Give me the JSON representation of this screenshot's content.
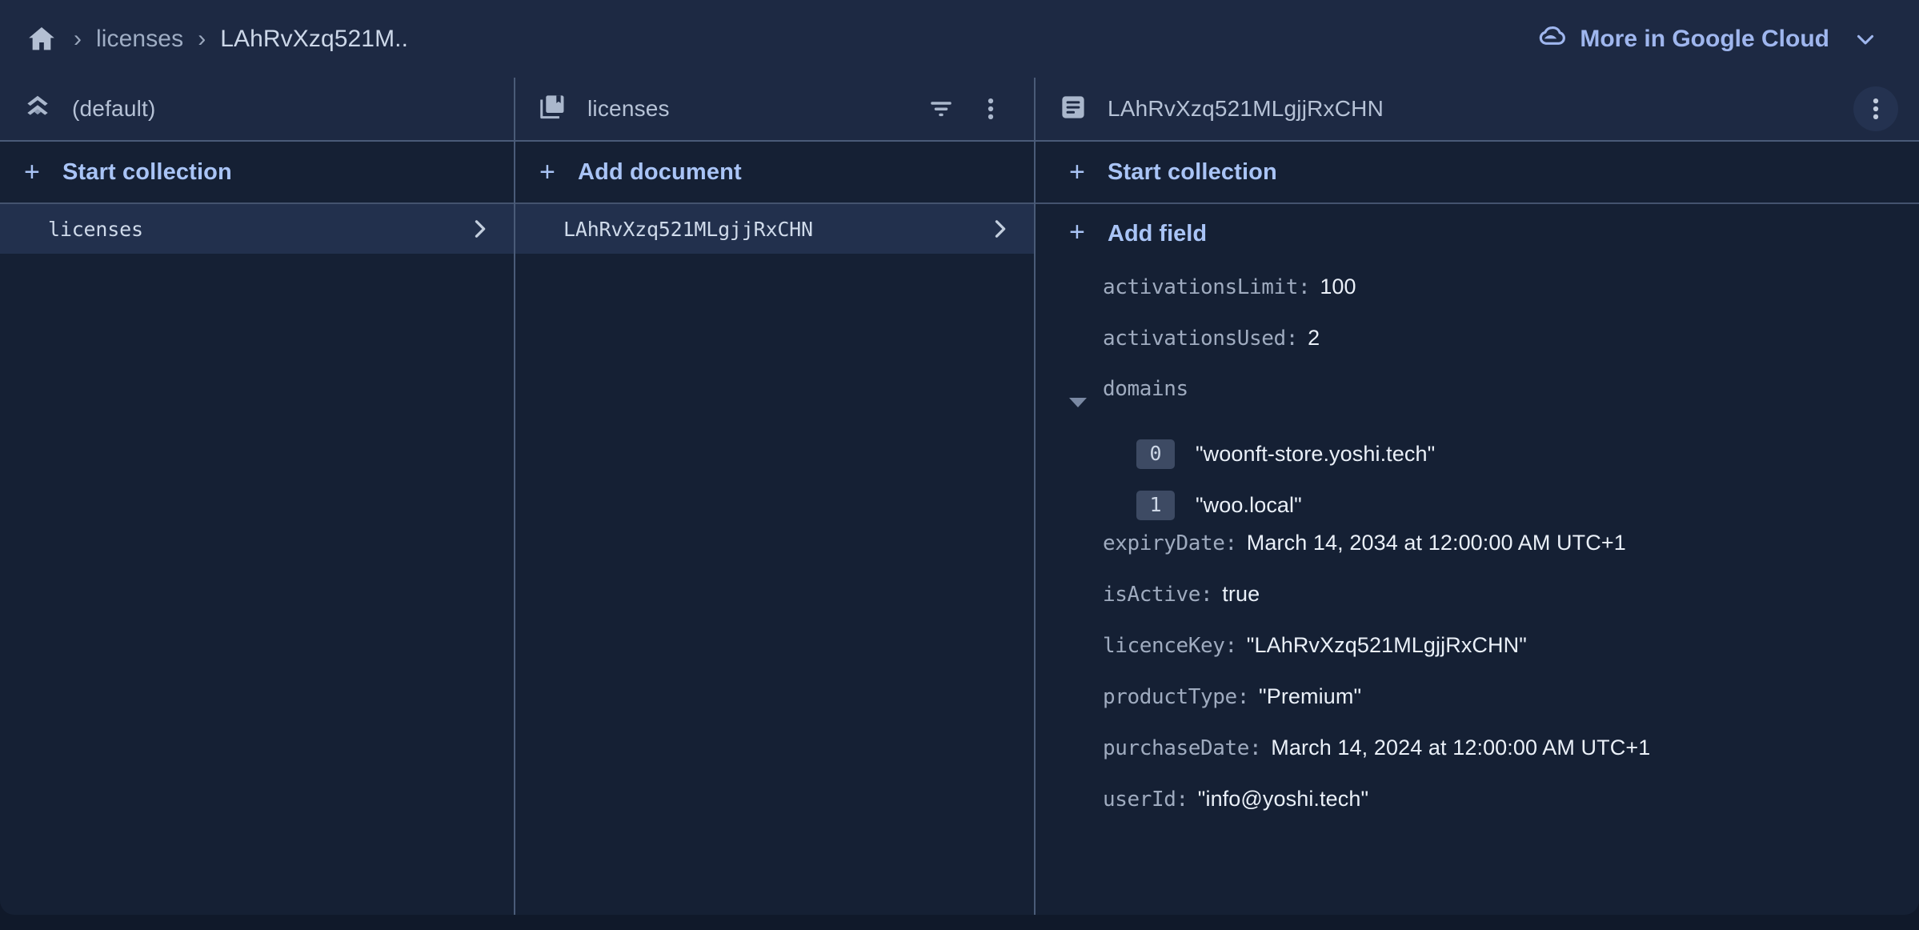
{
  "topbar": {
    "home_icon": "home-icon",
    "separator": "›",
    "crumb_collection": "licenses",
    "crumb_document": "LAhRvXzq521M..",
    "cloud_button_label": "More in Google Cloud",
    "cloud_icon": "google-cloud-icon",
    "chevron_icon": "chevron-down-icon",
    "accent_link": "#9fb6ee"
  },
  "columns": {
    "database": {
      "icon": "firestore-database-icon",
      "title": "(default)",
      "action_label": "Start collection",
      "action_plus": "+",
      "items": [
        {
          "name": "licenses",
          "selected": true,
          "chevron": "chevron-right-icon"
        }
      ]
    },
    "collection": {
      "icon": "collections-bookmark-icon",
      "title": "licenses",
      "filter_icon": "filter-icon",
      "menu_icon": "more-vert-icon",
      "action_label": "Add document",
      "action_plus": "+",
      "items": [
        {
          "name": "LAhRvXzq521MLgjjRxCHN",
          "selected": true,
          "chevron": "chevron-right-icon"
        }
      ]
    },
    "document": {
      "icon": "document-icon",
      "title": "LAhRvXzq521MLgjjRxCHN",
      "menu_icon": "more-vert-icon",
      "start_collection_label": "Start collection",
      "start_collection_plus": "+",
      "add_field_label": "Add field",
      "add_field_plus": "+",
      "fields": [
        {
          "key": "activationsLimit:",
          "value": "100"
        },
        {
          "key": "activationsUsed:",
          "value": "2"
        },
        {
          "key": "domains",
          "value": "",
          "expandable": true,
          "expanded": true
        },
        {
          "key": "expiryDate:",
          "value": "March 14, 2034 at 12:00:00 AM UTC+1"
        },
        {
          "key": "isActive:",
          "value": "true"
        },
        {
          "key": "licenceKey:",
          "value": "\"LAhRvXzq521MLgjjRxCHN\""
        },
        {
          "key": "productType:",
          "value": "\"Premium\""
        },
        {
          "key": "purchaseDate:",
          "value": "March 14, 2024 at 12:00:00 AM UTC+1"
        },
        {
          "key": "userId:",
          "value": "\"info@yoshi.tech\""
        }
      ],
      "domains_items": [
        {
          "index": "0",
          "value": "\"woonft-store.yoshi.tech\""
        },
        {
          "index": "1",
          "value": "\"woo.local\""
        }
      ]
    }
  },
  "colors": {
    "page_background": "#10192a",
    "panel_background": "#152034",
    "header_background": "#1d2943",
    "selected_row": "#22304d",
    "divider": "#4a5b78",
    "link_blue": "#a9c4f6",
    "key_grey": "#9fabbf",
    "value_white": "#eaf0f8"
  }
}
